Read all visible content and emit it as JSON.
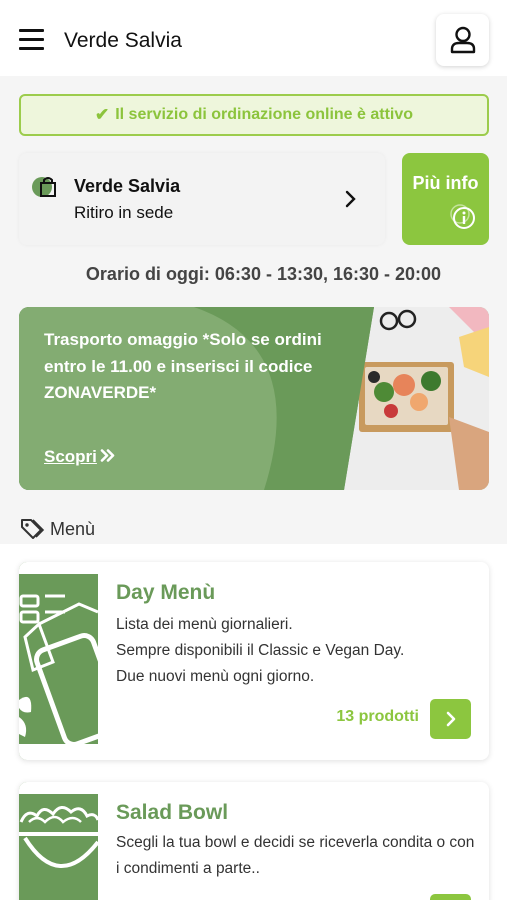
{
  "header": {
    "title": "Verde Salvia"
  },
  "notice": {
    "text": "Il servizio di ordinazione online è attivo"
  },
  "store": {
    "name": "Verde Salvia",
    "mode": "Ritiro in sede"
  },
  "info_button": {
    "label": "Più info"
  },
  "hours": {
    "text": "Orario di oggi: 06:30 - 13:30, 16:30 - 20:00"
  },
  "promo": {
    "text": "Trasporto omaggio *Solo se ordini entro le 11.00 e inserisci il codice ZONAVERDE*",
    "link": "Scopri"
  },
  "section": {
    "label": "Menù"
  },
  "categories": [
    {
      "title": "Day Menù",
      "description": "Lista dei menù giornalieri.\nSempre disponibili il Classic e Vegan Day.\nDue nuovi menù ogni giorno.",
      "count": "13 prodotti"
    },
    {
      "title": "Salad Bowl",
      "description": "Scegli la tua bowl e decidi se riceverla condita o con i condimenti a parte.."
    }
  ],
  "colors": {
    "accent": "#8cc63f",
    "brand_green": "#6a9a59",
    "notice_bg": "#eef6dc"
  },
  "icons": {
    "menu": "hamburger-icon",
    "user": "user-icon",
    "check": "check-icon",
    "bag": "shopping-bag-icon",
    "chevron": "chevron-right-icon",
    "info": "info-icon",
    "tag": "tag-icon"
  }
}
